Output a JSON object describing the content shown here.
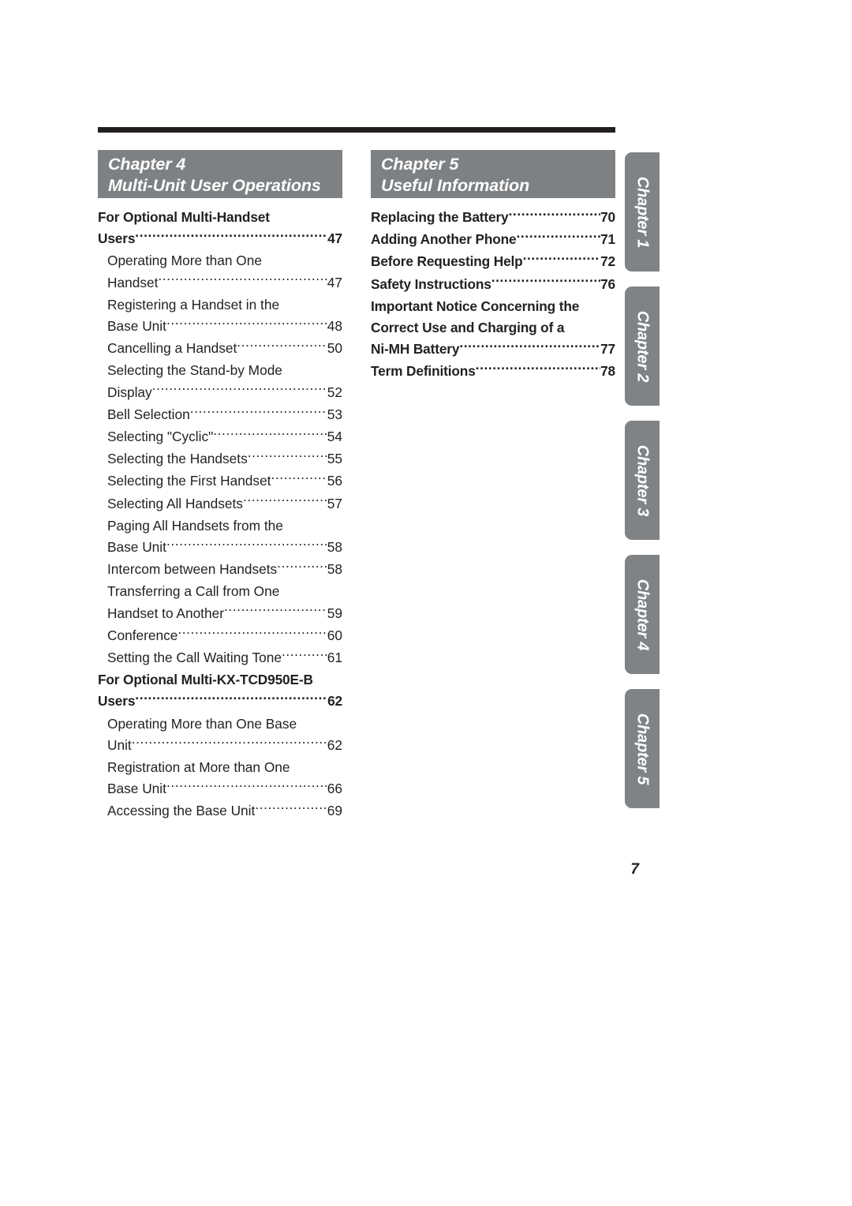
{
  "page": {
    "number": "7"
  },
  "columns": [
    {
      "header": {
        "chapter_label": "Chapter 4",
        "chapter_title": "Multi-Unit User Operations"
      },
      "entries": [
        {
          "level": 1,
          "lines": [
            "For Optional Multi-Handset",
            "Users"
          ],
          "page": "47"
        },
        {
          "level": 2,
          "lines": [
            "Operating More than One",
            "Handset "
          ],
          "page": "47"
        },
        {
          "level": 2,
          "lines": [
            "Registering a Handset in the",
            "Base Unit"
          ],
          "page": "48"
        },
        {
          "level": 2,
          "lines": [
            "Cancelling a Handset "
          ],
          "page": "50"
        },
        {
          "level": 2,
          "lines": [
            "Selecting the Stand-by Mode",
            "Display"
          ],
          "page": "52"
        },
        {
          "level": 2,
          "lines": [
            "Bell Selection"
          ],
          "page": "53"
        },
        {
          "level": 2,
          "lines": [
            "Selecting \"Cyclic\""
          ],
          "page": "54"
        },
        {
          "level": 2,
          "lines": [
            "Selecting the Handsets"
          ],
          "page": "55"
        },
        {
          "level": 2,
          "lines": [
            "Selecting the First Handset "
          ],
          "page": "56"
        },
        {
          "level": 2,
          "lines": [
            "Selecting All Handsets"
          ],
          "page": "57"
        },
        {
          "level": 2,
          "lines": [
            "Paging All Handsets from the",
            "Base Unit"
          ],
          "page": "58"
        },
        {
          "level": 2,
          "lines": [
            "Intercom between Handsets"
          ],
          "page": "58"
        },
        {
          "level": 2,
          "lines": [
            "Transferring a Call from One",
            "Handset to Another"
          ],
          "page": "59"
        },
        {
          "level": 2,
          "lines": [
            "Conference "
          ],
          "page": "60"
        },
        {
          "level": 2,
          "lines": [
            "Setting the Call Waiting Tone"
          ],
          "page": "61"
        },
        {
          "level": 1,
          "lines": [
            "For Optional Multi-KX-TCD950E-B",
            "Users"
          ],
          "page": "62"
        },
        {
          "level": 2,
          "lines": [
            "Operating More than One Base",
            "Unit"
          ],
          "page": "62"
        },
        {
          "level": 2,
          "lines": [
            "Registration at More than One",
            "Base Unit"
          ],
          "page": "66"
        },
        {
          "level": 2,
          "lines": [
            "Accessing the Base Unit"
          ],
          "page": "69"
        }
      ]
    },
    {
      "header": {
        "chapter_label": "Chapter 5",
        "chapter_title": "Useful Information"
      },
      "entries": [
        {
          "level": 1,
          "lines": [
            "Replacing the Battery"
          ],
          "page": "70"
        },
        {
          "level": 1,
          "lines": [
            "Adding Another Phone "
          ],
          "page": "71"
        },
        {
          "level": 1,
          "lines": [
            "Before Requesting Help "
          ],
          "page": "72"
        },
        {
          "level": 1,
          "lines": [
            "Safety Instructions "
          ],
          "page": "76"
        },
        {
          "level": 1,
          "lines": [
            "Important Notice Concerning the",
            "Correct Use and Charging of a",
            "Ni-MH Battery "
          ],
          "page": "77"
        },
        {
          "level": 1,
          "lines": [
            "Term Definitions"
          ],
          "page": "78"
        }
      ]
    }
  ],
  "side_tabs": [
    {
      "label": "Chapter 1"
    },
    {
      "label": "Chapter 2"
    },
    {
      "label": "Chapter 3"
    },
    {
      "label": "Chapter 4"
    },
    {
      "label": "Chapter 5"
    }
  ]
}
